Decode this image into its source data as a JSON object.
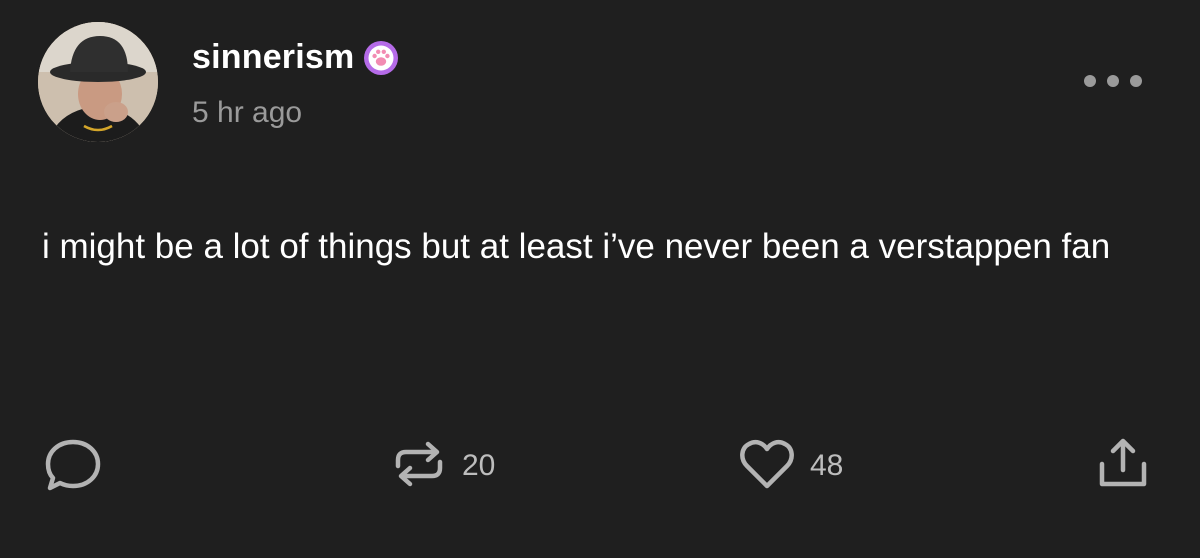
{
  "post": {
    "author": {
      "username": "sinnerism",
      "badge_icon": "paw-badge-icon",
      "avatar": "avatar"
    },
    "timestamp": "5 hr ago",
    "text": "i might be a lot of things but at least i’ve never been a verstappen fan",
    "actions": {
      "reply": {
        "icon": "comment-icon"
      },
      "reblog": {
        "icon": "reblog-icon",
        "count": "20"
      },
      "like": {
        "icon": "heart-icon",
        "count": "48"
      },
      "share": {
        "icon": "share-icon"
      }
    },
    "menu_icon": "more-options-icon"
  },
  "colors": {
    "background": "#1f1f1f",
    "text": "#ffffff",
    "muted": "#9a9a9a",
    "badge": "#b56be8"
  }
}
